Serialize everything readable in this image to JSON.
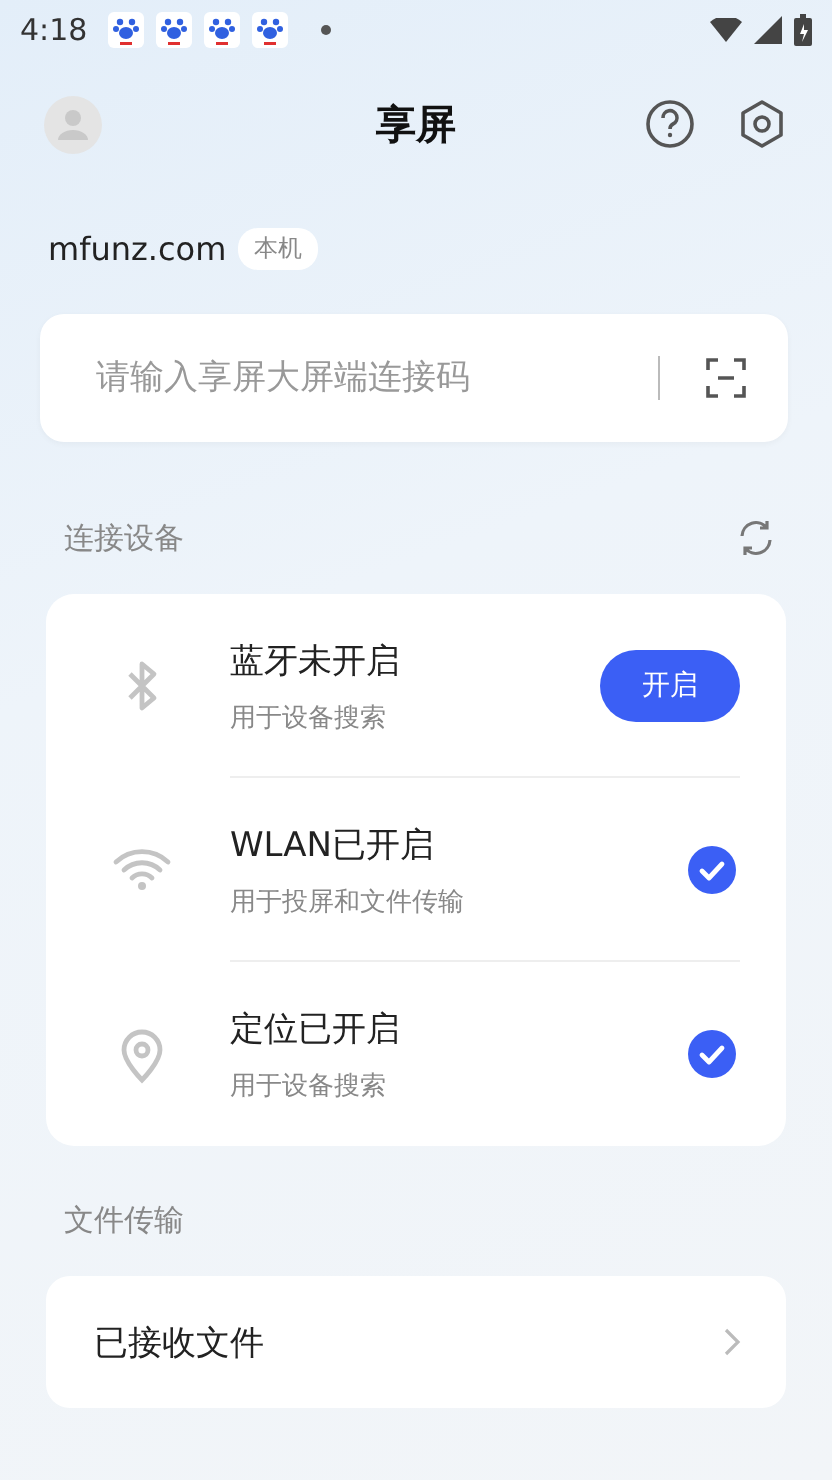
{
  "status_bar": {
    "time": "4:18",
    "notifications": [
      {
        "kind": "app"
      },
      {
        "kind": "app"
      },
      {
        "kind": "app"
      },
      {
        "kind": "app"
      }
    ]
  },
  "header": {
    "title": "享屏"
  },
  "device": {
    "name": "mfunz.com",
    "tag": "本机"
  },
  "connect_field": {
    "placeholder": "请输入享屏大屏端连接码"
  },
  "devices_section": {
    "title": "连接设备"
  },
  "connections": [
    {
      "kind": "bluetooth",
      "title": "蓝牙未开启",
      "subtitle": "用于设备搜索",
      "on": false,
      "action": "开启"
    },
    {
      "kind": "wifi",
      "title": "WLAN已开启",
      "subtitle": "用于投屏和文件传输",
      "on": true
    },
    {
      "kind": "location",
      "title": "定位已开启",
      "subtitle": "用于设备搜索",
      "on": true
    }
  ],
  "files_section": {
    "title": "文件传输"
  },
  "file_items": [
    {
      "label": "已接收文件"
    }
  ]
}
